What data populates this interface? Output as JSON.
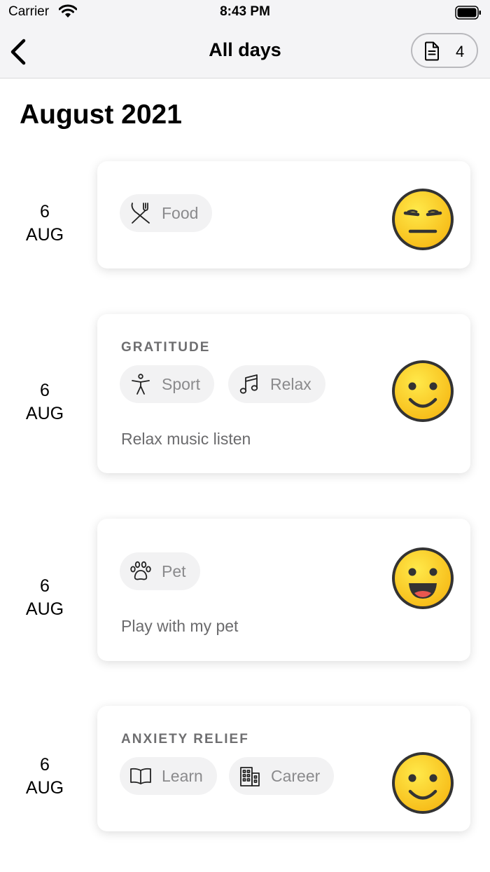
{
  "status_bar": {
    "carrier": "Carrier",
    "time": "8:43 PM"
  },
  "nav": {
    "title": "All days",
    "entries_count": "4"
  },
  "month": "August 2021",
  "entries": [
    {
      "day": "6",
      "month": "AUG",
      "tags": [
        {
          "icon": "fork-knife-icon",
          "label": "Food"
        }
      ],
      "mood": "neutral"
    },
    {
      "day": "6",
      "month": "AUG",
      "section": "GRATITUDE",
      "tags": [
        {
          "icon": "person-exercise-icon",
          "label": "Sport"
        },
        {
          "icon": "music-note-icon",
          "label": "Relax"
        }
      ],
      "note": "Relax music listen",
      "mood": "smile"
    },
    {
      "day": "6",
      "month": "AUG",
      "tags": [
        {
          "icon": "paw-icon",
          "label": "Pet"
        }
      ],
      "note": "Play with my pet",
      "mood": "happy"
    },
    {
      "day": "6",
      "month": "AUG",
      "section": "ANXIETY RELIEF",
      "tags": [
        {
          "icon": "book-icon",
          "label": "Learn"
        },
        {
          "icon": "building-icon",
          "label": "Career"
        }
      ],
      "mood": "smile"
    }
  ],
  "colors": {
    "emoji_yellow": "#fbd62a",
    "emoji_outline": "#3a3a3a",
    "tag_bg": "#f2f2f3"
  }
}
